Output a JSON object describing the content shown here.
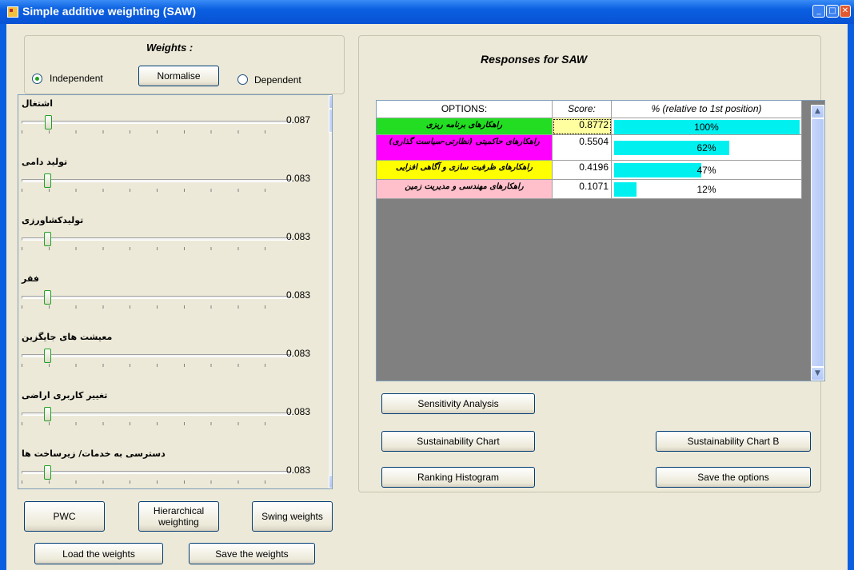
{
  "window": {
    "title": "Simple additive weighting (SAW)"
  },
  "weights": {
    "heading": "Weights :",
    "independent_label": "Independent",
    "normalise_label": "Normalise",
    "dependent_label": "Dependent",
    "selected": "independent",
    "criteria": [
      {
        "label": "اشتغال",
        "value": "0.087"
      },
      {
        "label": "تولید دامی",
        "value": "0.083"
      },
      {
        "label": "تولیدکشاورزی",
        "value": "0.083"
      },
      {
        "label": "فقر",
        "value": "0.083"
      },
      {
        "label": "معیشت های جایگزین",
        "value": "0.083"
      },
      {
        "label": "تغییر کاربری اراضی",
        "value": "0.083"
      },
      {
        "label": "دسترسی به خدمات/ زیرساخت ها",
        "value": "0.083"
      }
    ]
  },
  "buttons": {
    "pwc": "PWC",
    "hierarchical": "Hierarchical weighting",
    "swing": "Swing weights",
    "load": "Load the weights",
    "save_weights": "Save the weights",
    "sensitivity": "Sensitivity Analysis",
    "sustainability": "Sustainability Chart",
    "sustainability_b": "Sustainability Chart B",
    "ranking": "Ranking Histogram",
    "save_options": "Save the options"
  },
  "responses": {
    "heading": "Responses for SAW",
    "columns": [
      "OPTIONS:",
      "Score:",
      "% (relative to 1st position)"
    ],
    "rows": [
      {
        "option": "راهکارهای برنامه ریزی",
        "score": "0.8772",
        "percent": "100%",
        "fraction": 1.0,
        "color": "#22dd22"
      },
      {
        "option": "راهکارهای حاکمیتی (نظارتی-سیاست گذاری)",
        "score": "0.5504",
        "percent": "62%",
        "fraction": 0.62,
        "color": "#ff00ff"
      },
      {
        "option": "راهکارهای ظرفیت سازی و آگاهی افزایی",
        "score": "0.4196",
        "percent": "47%",
        "fraction": 0.47,
        "color": "#ffff00"
      },
      {
        "option": "راهکارهای مهندسی و مدیریت زمین",
        "score": "0.1071",
        "percent": "12%",
        "fraction": 0.12,
        "color": "#ffc0cb"
      }
    ]
  },
  "colors": {
    "bar": "#00f0f0",
    "selected_score": "#ffffa0"
  }
}
